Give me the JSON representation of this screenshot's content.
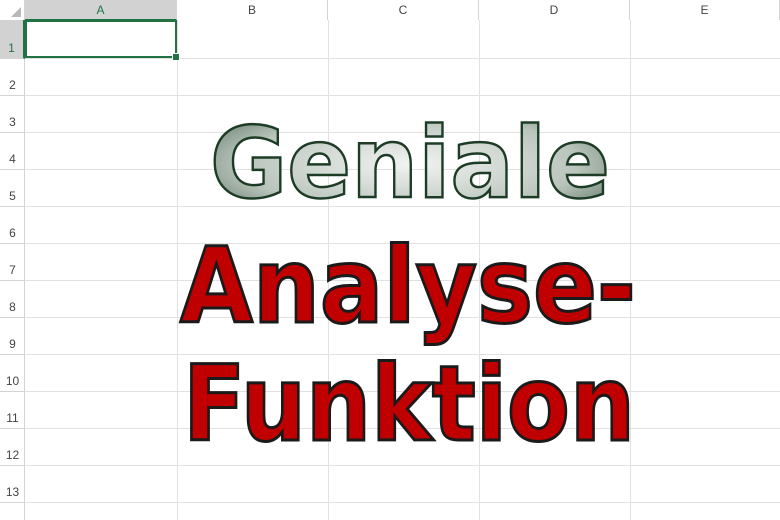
{
  "columns": [
    "A",
    "B",
    "C",
    "D",
    "E"
  ],
  "rows": [
    "1",
    "2",
    "3",
    "4",
    "5",
    "6",
    "7",
    "8",
    "9",
    "10",
    "11",
    "12",
    "13"
  ],
  "active_cell": {
    "column": "A",
    "row": "1"
  },
  "overlay": {
    "line1": "Geniale",
    "line2": "Analyse-",
    "line3": "Funktion",
    "line1_fill": "#b7c2b9",
    "line1_stroke": "#1d3c25",
    "red_fill": "#c00000",
    "red_stroke": "#1a1a1a"
  },
  "colors": {
    "accent": "#217346",
    "gridline": "#e1e1e1",
    "header_border": "#d4d4d4"
  }
}
